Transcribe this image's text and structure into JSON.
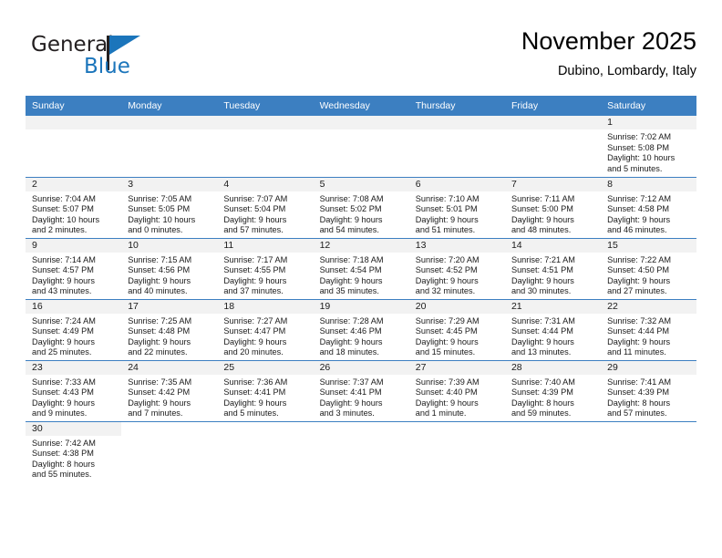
{
  "brand": {
    "name_top": "General",
    "name_bottom": "Blue",
    "accent_color": "#1b75bb"
  },
  "header": {
    "title": "November 2025",
    "subtitle": "Dubino, Lombardy, Italy"
  },
  "theme": {
    "header_row_color": "#3c7fc1",
    "daynum_bar_color": "#f2f2f2",
    "grid_line_color": "#3c7fc1",
    "text_color": "#1a1a1a"
  },
  "weekday_headers": [
    "Sunday",
    "Monday",
    "Tuesday",
    "Wednesday",
    "Thursday",
    "Friday",
    "Saturday"
  ],
  "weeks": [
    [
      {
        "day": "",
        "empty": true
      },
      {
        "day": "",
        "empty": true
      },
      {
        "day": "",
        "empty": true
      },
      {
        "day": "",
        "empty": true
      },
      {
        "day": "",
        "empty": true
      },
      {
        "day": "",
        "empty": true
      },
      {
        "day": "1",
        "sunrise": "Sunrise: 7:02 AM",
        "sunset": "Sunset: 5:08 PM",
        "daylight_1": "Daylight: 10 hours",
        "daylight_2": "and 5 minutes."
      }
    ],
    [
      {
        "day": "2",
        "sunrise": "Sunrise: 7:04 AM",
        "sunset": "Sunset: 5:07 PM",
        "daylight_1": "Daylight: 10 hours",
        "daylight_2": "and 2 minutes."
      },
      {
        "day": "3",
        "sunrise": "Sunrise: 7:05 AM",
        "sunset": "Sunset: 5:05 PM",
        "daylight_1": "Daylight: 10 hours",
        "daylight_2": "and 0 minutes."
      },
      {
        "day": "4",
        "sunrise": "Sunrise: 7:07 AM",
        "sunset": "Sunset: 5:04 PM",
        "daylight_1": "Daylight: 9 hours",
        "daylight_2": "and 57 minutes."
      },
      {
        "day": "5",
        "sunrise": "Sunrise: 7:08 AM",
        "sunset": "Sunset: 5:02 PM",
        "daylight_1": "Daylight: 9 hours",
        "daylight_2": "and 54 minutes."
      },
      {
        "day": "6",
        "sunrise": "Sunrise: 7:10 AM",
        "sunset": "Sunset: 5:01 PM",
        "daylight_1": "Daylight: 9 hours",
        "daylight_2": "and 51 minutes."
      },
      {
        "day": "7",
        "sunrise": "Sunrise: 7:11 AM",
        "sunset": "Sunset: 5:00 PM",
        "daylight_1": "Daylight: 9 hours",
        "daylight_2": "and 48 minutes."
      },
      {
        "day": "8",
        "sunrise": "Sunrise: 7:12 AM",
        "sunset": "Sunset: 4:58 PM",
        "daylight_1": "Daylight: 9 hours",
        "daylight_2": "and 46 minutes."
      }
    ],
    [
      {
        "day": "9",
        "sunrise": "Sunrise: 7:14 AM",
        "sunset": "Sunset: 4:57 PM",
        "daylight_1": "Daylight: 9 hours",
        "daylight_2": "and 43 minutes."
      },
      {
        "day": "10",
        "sunrise": "Sunrise: 7:15 AM",
        "sunset": "Sunset: 4:56 PM",
        "daylight_1": "Daylight: 9 hours",
        "daylight_2": "and 40 minutes."
      },
      {
        "day": "11",
        "sunrise": "Sunrise: 7:17 AM",
        "sunset": "Sunset: 4:55 PM",
        "daylight_1": "Daylight: 9 hours",
        "daylight_2": "and 37 minutes."
      },
      {
        "day": "12",
        "sunrise": "Sunrise: 7:18 AM",
        "sunset": "Sunset: 4:54 PM",
        "daylight_1": "Daylight: 9 hours",
        "daylight_2": "and 35 minutes."
      },
      {
        "day": "13",
        "sunrise": "Sunrise: 7:20 AM",
        "sunset": "Sunset: 4:52 PM",
        "daylight_1": "Daylight: 9 hours",
        "daylight_2": "and 32 minutes."
      },
      {
        "day": "14",
        "sunrise": "Sunrise: 7:21 AM",
        "sunset": "Sunset: 4:51 PM",
        "daylight_1": "Daylight: 9 hours",
        "daylight_2": "and 30 minutes."
      },
      {
        "day": "15",
        "sunrise": "Sunrise: 7:22 AM",
        "sunset": "Sunset: 4:50 PM",
        "daylight_1": "Daylight: 9 hours",
        "daylight_2": "and 27 minutes."
      }
    ],
    [
      {
        "day": "16",
        "sunrise": "Sunrise: 7:24 AM",
        "sunset": "Sunset: 4:49 PM",
        "daylight_1": "Daylight: 9 hours",
        "daylight_2": "and 25 minutes."
      },
      {
        "day": "17",
        "sunrise": "Sunrise: 7:25 AM",
        "sunset": "Sunset: 4:48 PM",
        "daylight_1": "Daylight: 9 hours",
        "daylight_2": "and 22 minutes."
      },
      {
        "day": "18",
        "sunrise": "Sunrise: 7:27 AM",
        "sunset": "Sunset: 4:47 PM",
        "daylight_1": "Daylight: 9 hours",
        "daylight_2": "and 20 minutes."
      },
      {
        "day": "19",
        "sunrise": "Sunrise: 7:28 AM",
        "sunset": "Sunset: 4:46 PM",
        "daylight_1": "Daylight: 9 hours",
        "daylight_2": "and 18 minutes."
      },
      {
        "day": "20",
        "sunrise": "Sunrise: 7:29 AM",
        "sunset": "Sunset: 4:45 PM",
        "daylight_1": "Daylight: 9 hours",
        "daylight_2": "and 15 minutes."
      },
      {
        "day": "21",
        "sunrise": "Sunrise: 7:31 AM",
        "sunset": "Sunset: 4:44 PM",
        "daylight_1": "Daylight: 9 hours",
        "daylight_2": "and 13 minutes."
      },
      {
        "day": "22",
        "sunrise": "Sunrise: 7:32 AM",
        "sunset": "Sunset: 4:44 PM",
        "daylight_1": "Daylight: 9 hours",
        "daylight_2": "and 11 minutes."
      }
    ],
    [
      {
        "day": "23",
        "sunrise": "Sunrise: 7:33 AM",
        "sunset": "Sunset: 4:43 PM",
        "daylight_1": "Daylight: 9 hours",
        "daylight_2": "and 9 minutes."
      },
      {
        "day": "24",
        "sunrise": "Sunrise: 7:35 AM",
        "sunset": "Sunset: 4:42 PM",
        "daylight_1": "Daylight: 9 hours",
        "daylight_2": "and 7 minutes."
      },
      {
        "day": "25",
        "sunrise": "Sunrise: 7:36 AM",
        "sunset": "Sunset: 4:41 PM",
        "daylight_1": "Daylight: 9 hours",
        "daylight_2": "and 5 minutes."
      },
      {
        "day": "26",
        "sunrise": "Sunrise: 7:37 AM",
        "sunset": "Sunset: 4:41 PM",
        "daylight_1": "Daylight: 9 hours",
        "daylight_2": "and 3 minutes."
      },
      {
        "day": "27",
        "sunrise": "Sunrise: 7:39 AM",
        "sunset": "Sunset: 4:40 PM",
        "daylight_1": "Daylight: 9 hours",
        "daylight_2": "and 1 minute."
      },
      {
        "day": "28",
        "sunrise": "Sunrise: 7:40 AM",
        "sunset": "Sunset: 4:39 PM",
        "daylight_1": "Daylight: 8 hours",
        "daylight_2": "and 59 minutes."
      },
      {
        "day": "29",
        "sunrise": "Sunrise: 7:41 AM",
        "sunset": "Sunset: 4:39 PM",
        "daylight_1": "Daylight: 8 hours",
        "daylight_2": "and 57 minutes."
      }
    ],
    [
      {
        "day": "30",
        "sunrise": "Sunrise: 7:42 AM",
        "sunset": "Sunset: 4:38 PM",
        "daylight_1": "Daylight: 8 hours",
        "daylight_2": "and 55 minutes."
      },
      {
        "day": "",
        "blank": true
      },
      {
        "day": "",
        "blank": true
      },
      {
        "day": "",
        "blank": true
      },
      {
        "day": "",
        "blank": true
      },
      {
        "day": "",
        "blank": true
      },
      {
        "day": "",
        "blank": true
      }
    ]
  ]
}
